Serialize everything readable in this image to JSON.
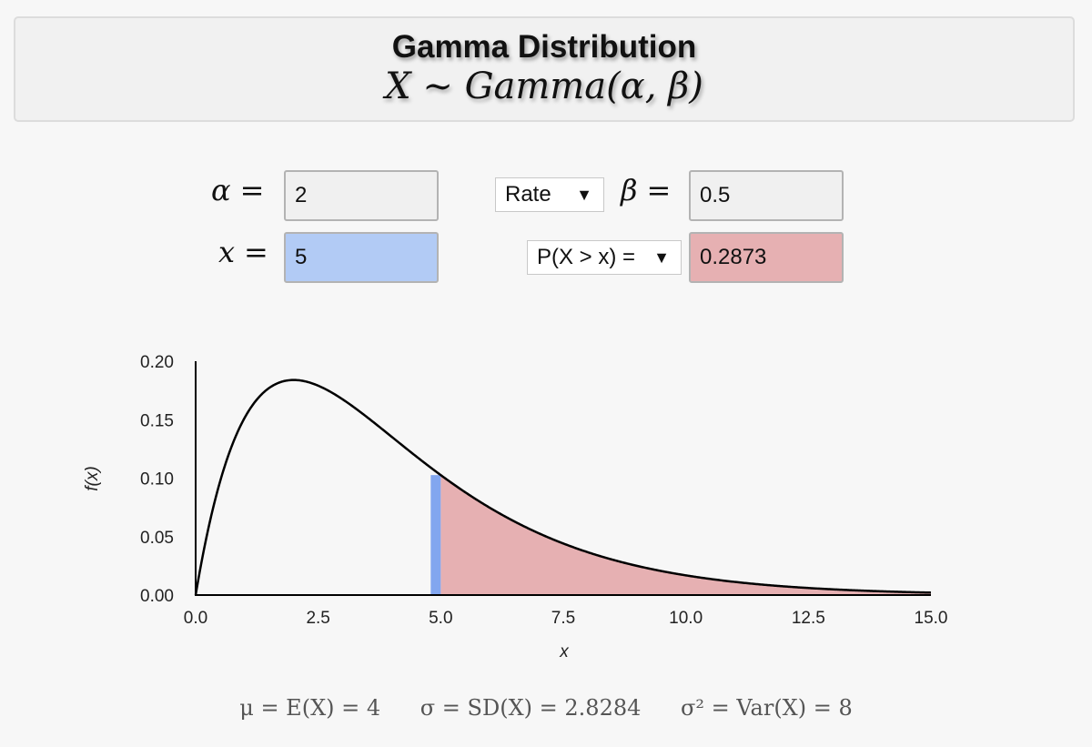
{
  "header": {
    "title": "Gamma Distribution",
    "subtitle": "X ∼ Gamma(α, β)"
  },
  "controls": {
    "alpha_label": "α",
    "alpha_value": "2",
    "x_label": "x",
    "x_value": "5",
    "param_type_select": "Rate",
    "beta_label": "β",
    "beta_value": "0.5",
    "prob_type_select": "P(X > x) =",
    "prob_value": "0.2873",
    "equals": "="
  },
  "colors": {
    "x_field": "#b2cbf5",
    "prob_field": "#e6b0b2",
    "marker": "#82a6ef",
    "tail_fill": "#e6b0b2",
    "curve": "#000000"
  },
  "chart_data": {
    "type": "area",
    "title": "",
    "xlabel": "x",
    "ylabel": "f(x)",
    "distribution": "gamma",
    "alpha": 2,
    "beta_rate": 0.5,
    "x_marker": 5,
    "shaded_region": "x > 5",
    "shaded_probability": 0.2873,
    "xlim": [
      0,
      15
    ],
    "ylim": [
      0,
      0.2
    ],
    "xticks": [
      "0.0",
      "2.5",
      "5.0",
      "7.5",
      "10.0",
      "12.5",
      "15.0"
    ],
    "yticks": [
      "0.00",
      "0.05",
      "0.10",
      "0.15",
      "0.20"
    ],
    "grid": false,
    "legend": "none"
  },
  "stats": {
    "mean": "μ = E(X) = 4",
    "sd": "σ = SD(X) = 2.8284",
    "var": "σ² = Var(X) = 8"
  }
}
